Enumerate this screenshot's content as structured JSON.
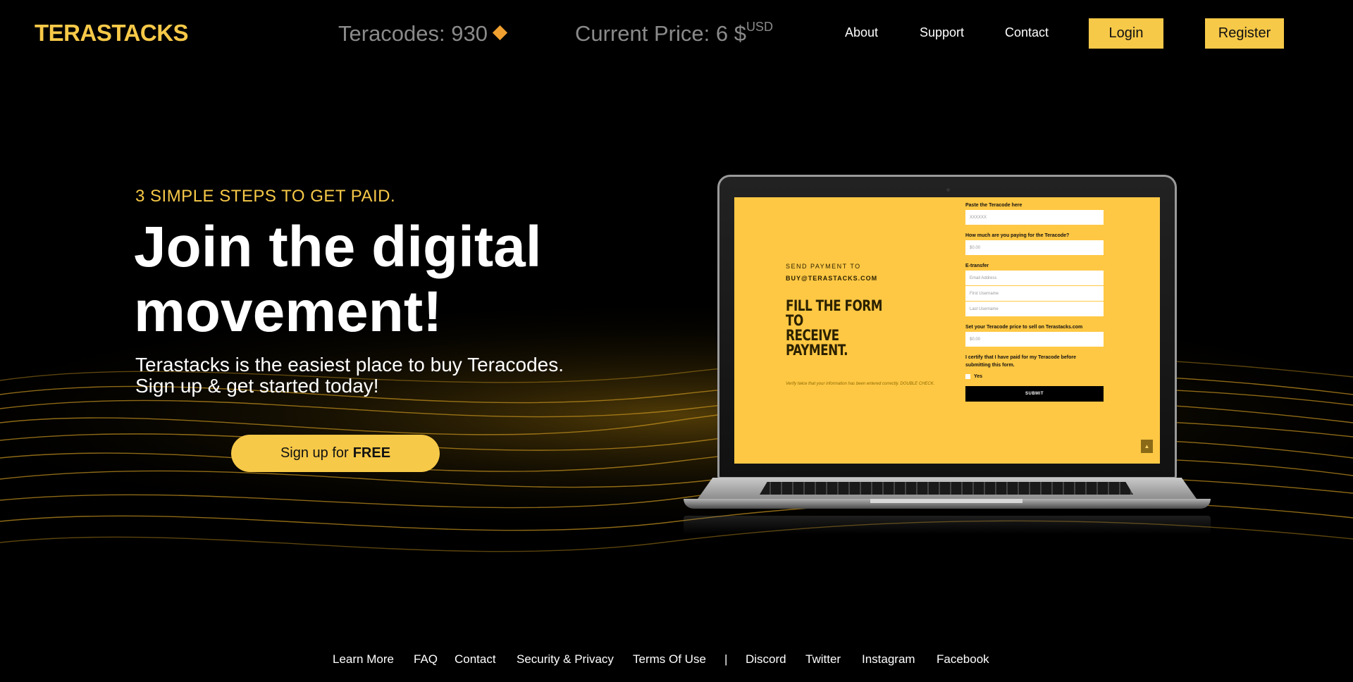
{
  "header": {
    "logo": "TERASTACKS",
    "teracodes_label": "Teracodes: 930",
    "price_label": "Current Price: 6 $",
    "price_unit": "USD",
    "nav": {
      "about": "About",
      "support": "Support",
      "contact": "Contact"
    },
    "login": "Login",
    "register": "Register"
  },
  "hero": {
    "eyebrow": "3 SIMPLE STEPS TO GET PAID.",
    "headline_line1": "Join the digital",
    "headline_line2": "movement!",
    "sub_line1": "Terastacks is the easiest place to buy Teracodes.",
    "sub_line2": "Sign up & get started today!",
    "cta_prefix": "Sign up for",
    "cta_emphasis": "FREE"
  },
  "screen": {
    "send_payment": "SEND PAYMENT TO",
    "email": "BUY@TERASTACKS.COM",
    "heading_line1": "FILL THE FORM TO",
    "heading_line2": "RECEIVE PAYMENT.",
    "note": "Verify twice that your information has been entered correctly. DOUBLE CHECK.",
    "form": {
      "teracode_label": "Paste the Teracode here",
      "teracode_placeholder": "XXXXXX",
      "paying_label": "How much are you paying for the Teracode?",
      "paying_placeholder": "$0.00",
      "etransfer_label": "E-transfer",
      "email_placeholder": "Email Address",
      "first_placeholder": "First Username",
      "last_placeholder": "Last Username",
      "price_label": "Set your Teracode price to sell on Terastacks.com",
      "price_placeholder": "$0.00",
      "certify_line1": "I certify that I have paid for my Teracode before",
      "certify_line2": "submitting this form.",
      "yes": "Yes",
      "submit": "SUBMIT"
    },
    "scroll_top": "▲"
  },
  "footer": {
    "learn_more": "Learn More",
    "faq": "FAQ",
    "contact": "Contact",
    "security": "Security & Privacy",
    "terms": "Terms Of Use",
    "divider": "|",
    "discord": "Discord",
    "twitter": "Twitter",
    "instagram": "Instagram",
    "facebook": "Facebook"
  },
  "colors": {
    "accent": "#f7c948",
    "background": "#000000",
    "screen_bg": "#ffc844"
  }
}
